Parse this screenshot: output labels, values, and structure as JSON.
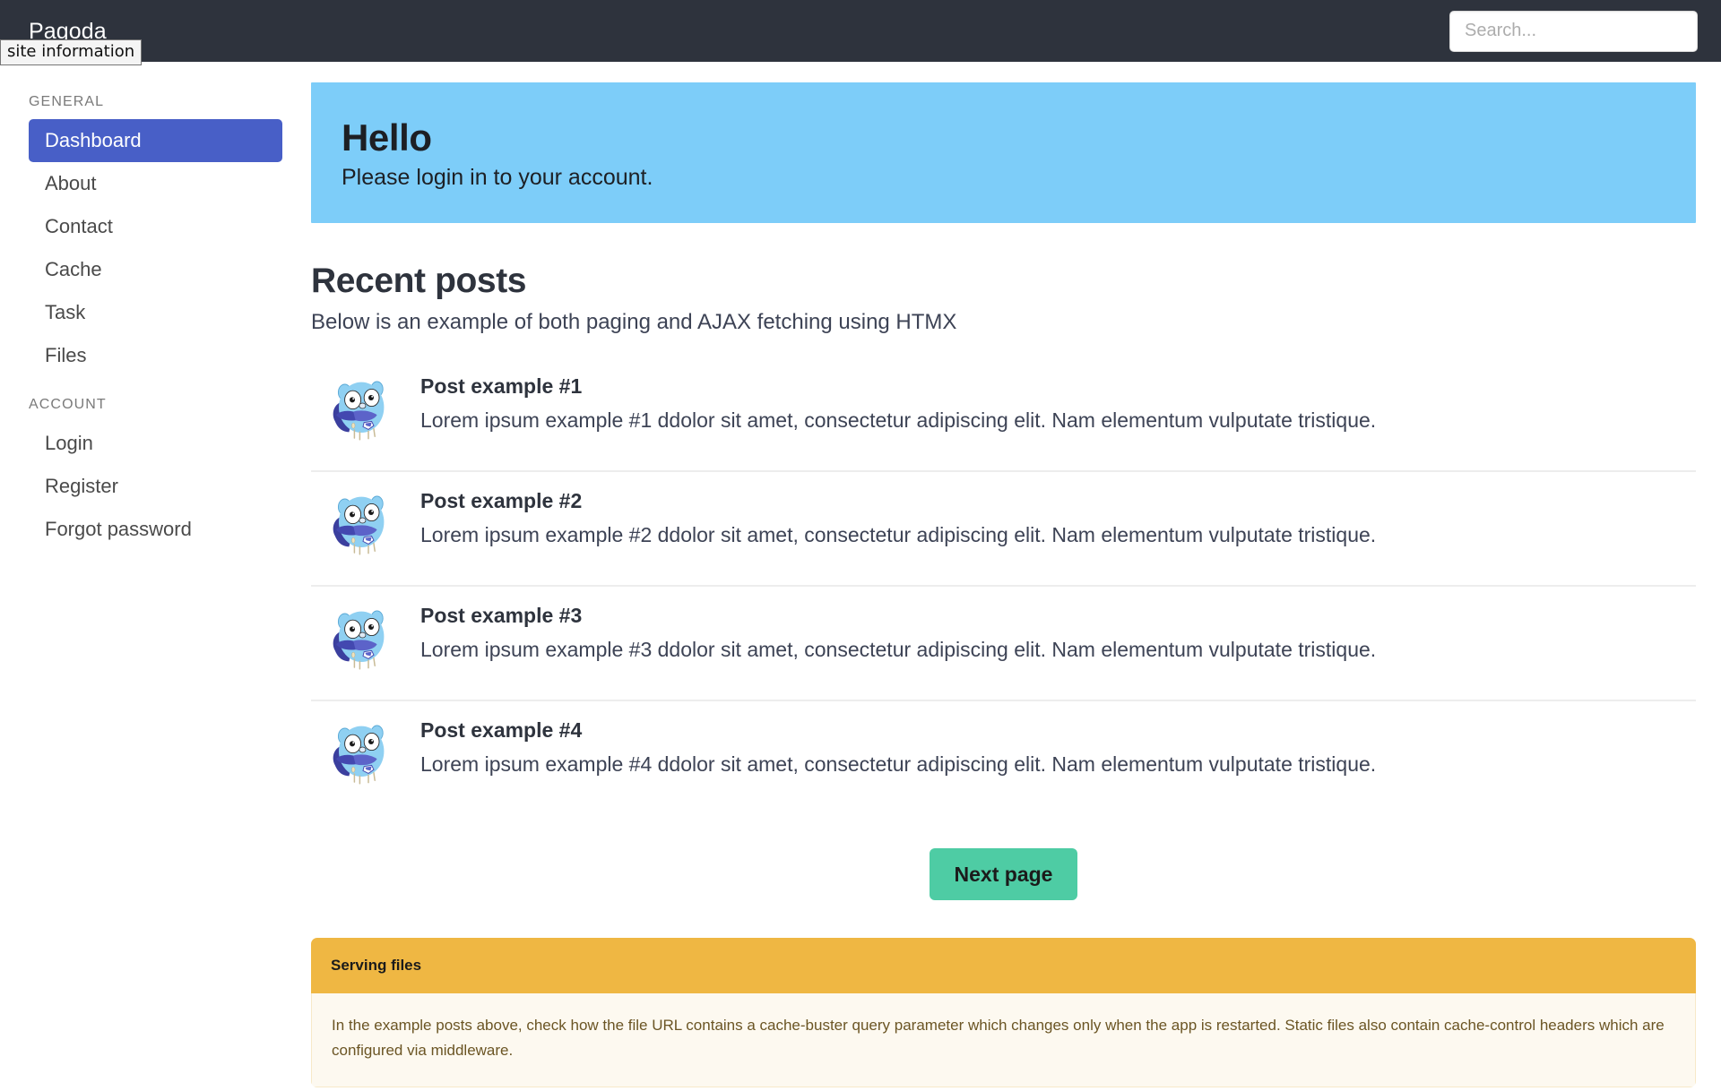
{
  "navbar": {
    "brand": "Pagoda",
    "tooltip": "site information",
    "search": {
      "placeholder": "Search...",
      "value": ""
    }
  },
  "sidebar": {
    "groups": [
      {
        "label": "GENERAL",
        "items": [
          {
            "label": "Dashboard",
            "active": true
          },
          {
            "label": "About",
            "active": false
          },
          {
            "label": "Contact",
            "active": false
          },
          {
            "label": "Cache",
            "active": false
          },
          {
            "label": "Task",
            "active": false
          },
          {
            "label": "Files",
            "active": false
          }
        ]
      },
      {
        "label": "ACCOUNT",
        "items": [
          {
            "label": "Login",
            "active": false
          },
          {
            "label": "Register",
            "active": false
          },
          {
            "label": "Forgot password",
            "active": false
          }
        ]
      }
    ]
  },
  "hero": {
    "title": "Hello",
    "subtitle": "Please login in to your account.",
    "background_color": "#7dcdf9"
  },
  "section": {
    "title": "Recent posts",
    "subtitle": "Below is an example of both paging and AJAX fetching using HTMX"
  },
  "posts": [
    {
      "avatar": "go-gopher-icon",
      "title": "Post example #1",
      "description": "Lorem ipsum example #1 ddolor sit amet, consectetur adipiscing elit. Nam elementum vulputate tristique."
    },
    {
      "avatar": "go-gopher-icon",
      "title": "Post example #2",
      "description": "Lorem ipsum example #2 ddolor sit amet, consectetur adipiscing elit. Nam elementum vulputate tristique."
    },
    {
      "avatar": "go-gopher-icon",
      "title": "Post example #3",
      "description": "Lorem ipsum example #3 ddolor sit amet, consectetur adipiscing elit. Nam elementum vulputate tristique."
    },
    {
      "avatar": "go-gopher-icon",
      "title": "Post example #4",
      "description": "Lorem ipsum example #4 ddolor sit amet, consectetur adipiscing elit. Nam elementum vulputate tristique."
    }
  ],
  "pager": {
    "next_label": "Next page",
    "button_color": "#4ecca4"
  },
  "message": {
    "header": "Serving files",
    "body": "In the example posts above, check how the file URL contains a cache-buster query parameter which changes only when the app is restarted. Static files also contain cache-control headers which are configured via middleware.",
    "header_color": "#efb743",
    "body_color": "#fdf9f0"
  },
  "theme": {
    "navbar_background": "#2e333d",
    "active_menu_color": "#485fc7",
    "text_color": "#3d4355"
  }
}
